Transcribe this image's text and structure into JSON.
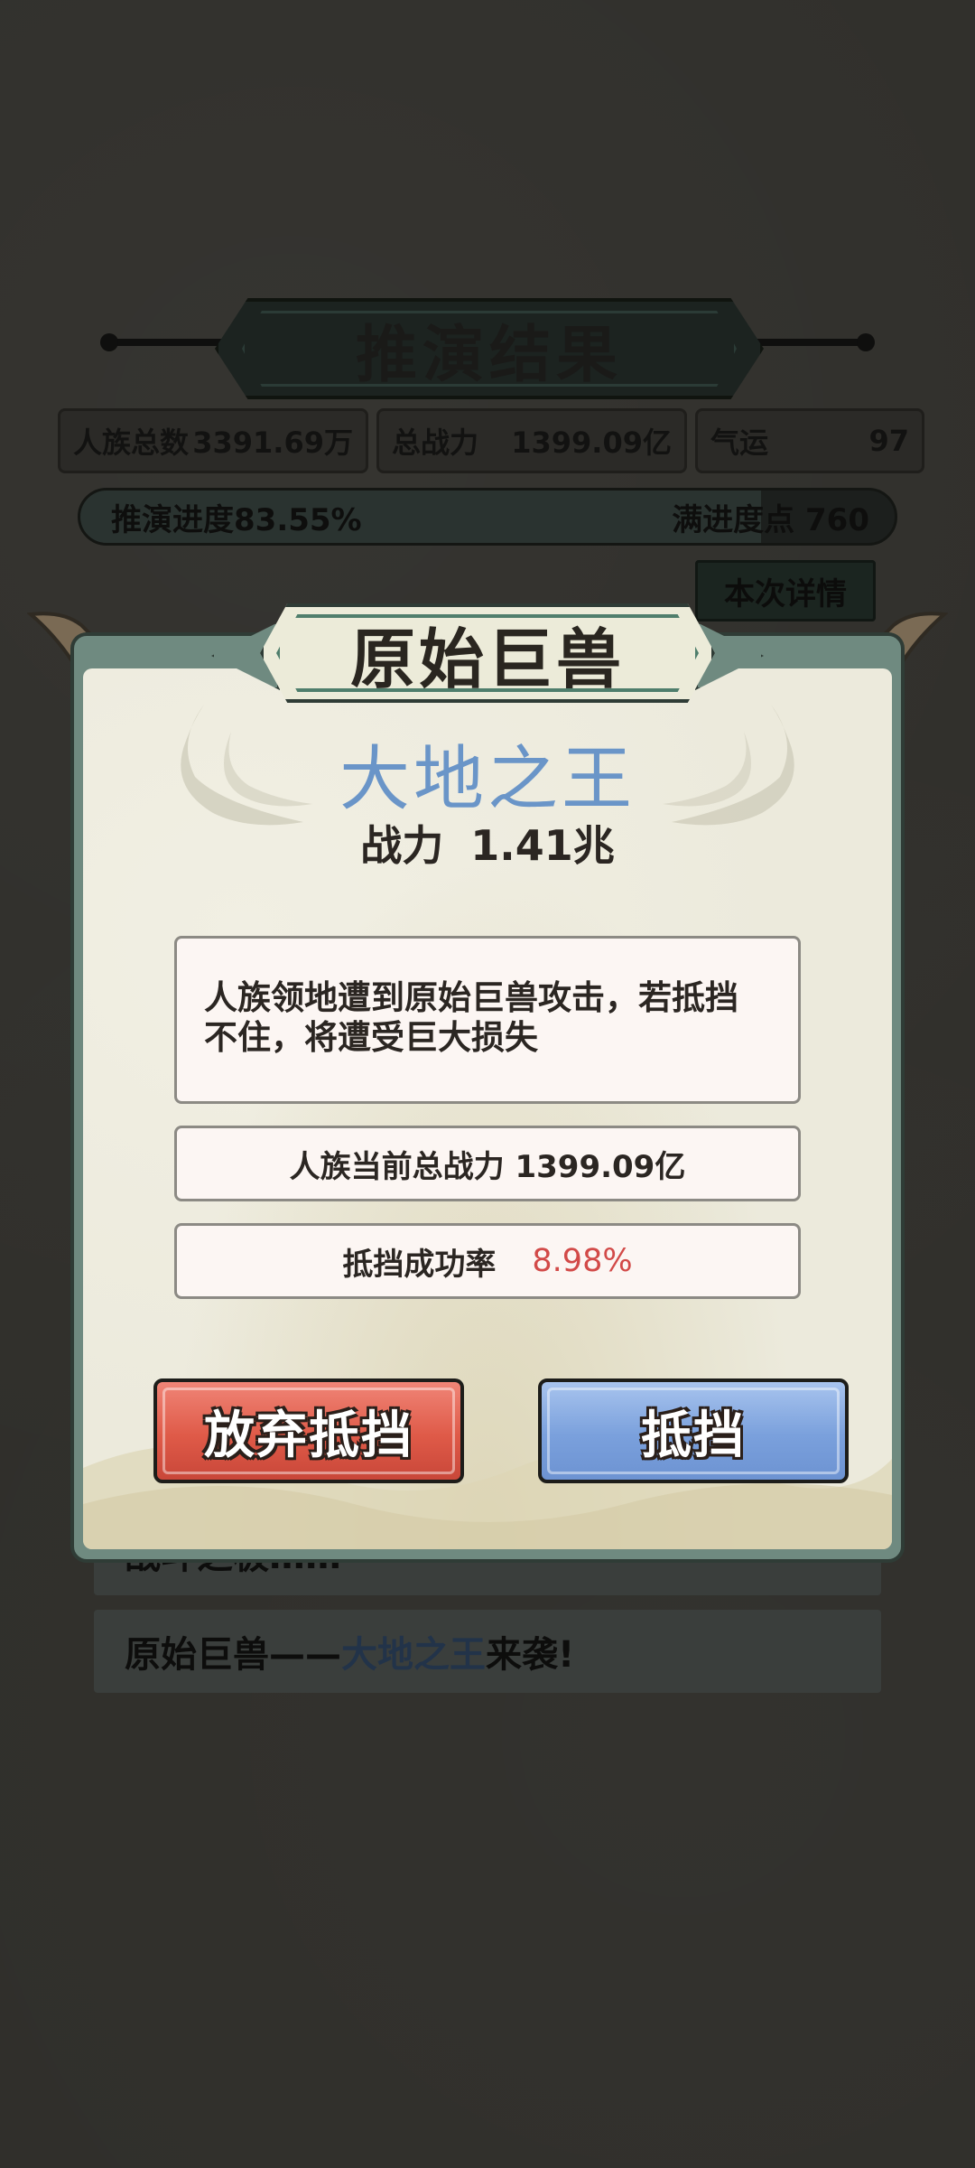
{
  "header": {
    "title": "推演结果",
    "stats": [
      {
        "label": "人族总数",
        "value": "3391.69万"
      },
      {
        "label": "总战力",
        "value": "1399.09亿"
      },
      {
        "label": "气运",
        "value": "97"
      }
    ],
    "progress": {
      "label": "推演进度83.55%",
      "fraction": 0.8355,
      "points_label": "满进度点 760"
    },
    "details_button": "本次详情"
  },
  "background_list": {
    "partial_item": "战斗之极……",
    "event_prefix": "原始巨兽——",
    "event_highlight": "大地之王",
    "event_suffix": "来袭!"
  },
  "modal": {
    "title": "原始巨兽",
    "beast_name": "大地之王",
    "power_label": "战力",
    "power_value": "1.41兆",
    "description": "人族领地遭到原始巨兽攻击，若抵挡不住，将遭受巨大损失",
    "current_power_text": "人族当前总战力 1399.09亿",
    "success_rate_label": "抵挡成功率",
    "success_rate_value": "8.98%",
    "buttons": {
      "abandon": "放弃抵挡",
      "resist": "抵挡"
    }
  },
  "colors": {
    "beast_name": "#6a95c8",
    "rate": "#d24a48",
    "abandon_button": "#df5a48",
    "resist_button": "#7aa0dc",
    "frame": "#6f8a80"
  }
}
